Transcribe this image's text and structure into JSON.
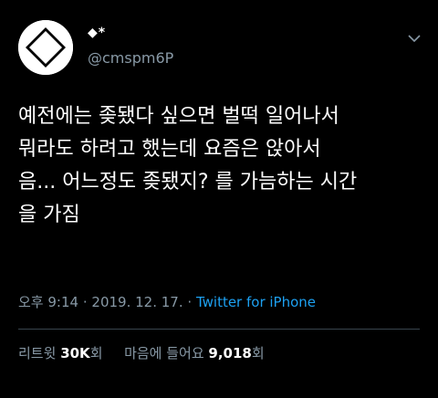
{
  "user": {
    "display_name": "◆*",
    "handle": "@cmspm6P",
    "avatar_icon": "white-diamond-avatar-icon"
  },
  "menu_icon": "chevron-down-icon",
  "tweet": {
    "text": "예전에는 좆됐다 싶으면 벌떡 일어나서\n뭐라도 하려고 했는데 요즘은 앉아서\n음... 어느정도 좆됐지? 를 가늠하는 시간\n을 가짐"
  },
  "meta": {
    "time": "오후 9:14",
    "separator": "·",
    "date": "2019. 12. 17.",
    "source": "Twitter for iPhone"
  },
  "stats": {
    "retweets_label": "리트윗",
    "retweets_count": "30K",
    "retweets_unit": "회",
    "likes_label": "마음에 들어요",
    "likes_count": "9,018",
    "likes_unit": "회"
  },
  "colors": {
    "background": "#000000",
    "text": "#ffffff",
    "muted": "#8899a6",
    "link": "#1da1f2",
    "divider": "#38444d"
  }
}
